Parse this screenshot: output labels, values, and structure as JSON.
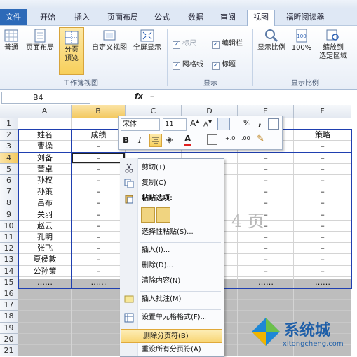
{
  "tabs": [
    "文件",
    "开始",
    "插入",
    "页面布局",
    "公式",
    "数据",
    "审阅",
    "视图",
    "福昕阅读器"
  ],
  "ribbon": {
    "workbook_views": {
      "normal": "普通",
      "page_layout": "页面布局",
      "page_break_1": "分页",
      "page_break_2": "预览",
      "custom": "自定义视图",
      "full": "全屏显示",
      "group": "工作簿视图"
    },
    "show": {
      "ruler": "标尺",
      "formula_bar": "编辑栏",
      "gridlines": "网格线",
      "headings": "标题",
      "group": "显示"
    },
    "zoom": {
      "zoom": "显示比例",
      "pct": "100%",
      "fit_1": "缩放到",
      "fit_2": "选定区域",
      "group": "显示比例"
    }
  },
  "namebox": "B4",
  "fx": "fx",
  "formula_value": "–",
  "columns": [
    "A",
    "B",
    "C",
    "D",
    "E",
    "F"
  ],
  "rows": [
    "1",
    "2",
    "3",
    "4",
    "5",
    "6",
    "7",
    "8",
    "9",
    "10",
    "11",
    "12",
    "13",
    "14",
    "15",
    "16",
    "17",
    "18",
    "19",
    "20",
    "21"
  ],
  "names": [
    "姓名",
    "曹操",
    "刘备",
    "董卓",
    "孙权",
    "孙策",
    "吕布",
    "关羽",
    "赵云",
    "孔明",
    "张飞",
    "夏侯敦",
    "公孙策",
    "……"
  ],
  "col_b_header": "成绩",
  "col_f_header": "策略",
  "dash": "–",
  "dots": "……",
  "page_watermark": "4 页",
  "mini_toolbar": {
    "font": "宋体",
    "size": "11",
    "bold": "B",
    "italic": "I",
    "percent": "%",
    "comma": ","
  },
  "menu": {
    "cut": "剪切(T)",
    "copy": "复制(C)",
    "paste_options": "粘贴选项:",
    "paste_special": "选择性粘贴(S)...",
    "insert": "插入(I)...",
    "delete": "删除(D)...",
    "clear": "清除内容(N)",
    "insert_comment": "插入批注(M)",
    "format_cells": "设置单元格格式(F)...",
    "remove_break": "删除分页符(B)",
    "reset_breaks": "重设所有分页符(A)"
  },
  "watermark": {
    "cn": "系统城",
    "en": "xitongcheng.com"
  }
}
